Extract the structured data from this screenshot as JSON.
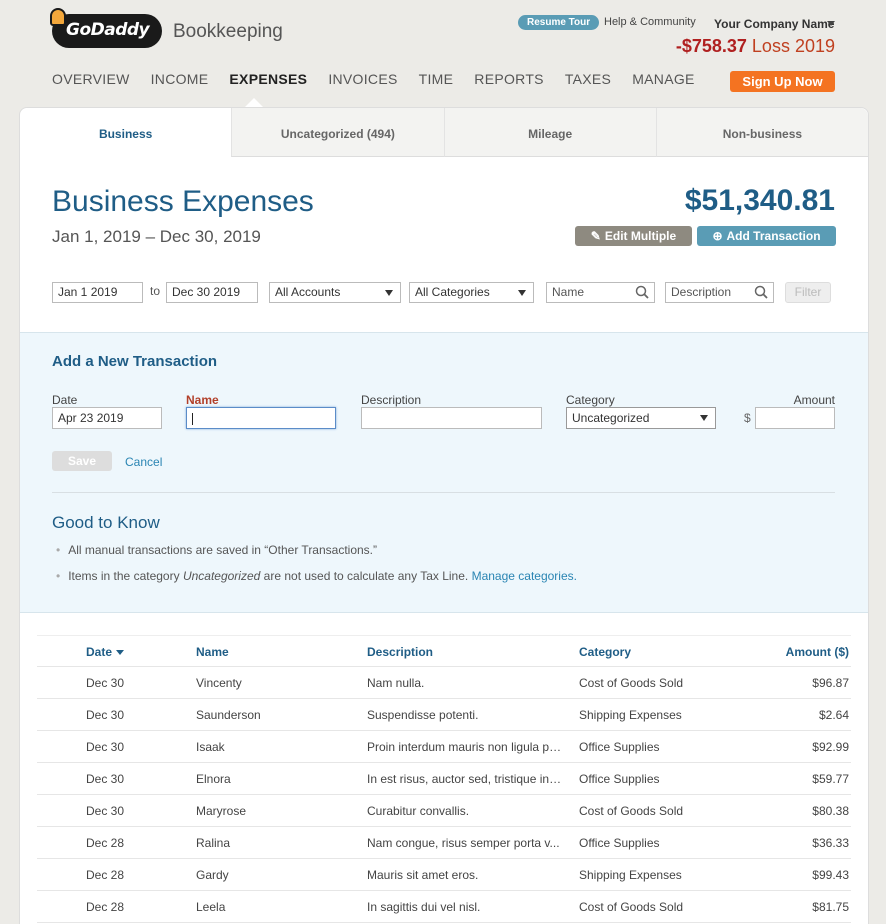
{
  "header": {
    "logo_text": "GoDaddy",
    "product": "Bookkeeping",
    "resume_tour": "Resume Tour",
    "help": "Help & Community",
    "company": "Your Company Name",
    "pl_amount": "-$758.37",
    "pl_label": "Loss 2019",
    "signup": "Sign Up Now"
  },
  "nav": [
    "OVERVIEW",
    "INCOME",
    "EXPENSES",
    "INVOICES",
    "TIME",
    "REPORTS",
    "TAXES",
    "MANAGE"
  ],
  "nav_active": "EXPENSES",
  "tabs": [
    "Business",
    "Uncategorized (494)",
    "Mileage",
    "Non-business"
  ],
  "page": {
    "title": "Business Expenses",
    "date_range": "Jan 1, 2019 – Dec 30, 2019",
    "total": "$51,340.81",
    "edit_multiple": "Edit Multiple",
    "add_transaction": "Add Transaction"
  },
  "filters": {
    "from": "Jan 1 2019",
    "to_label": "to",
    "to": "Dec 30 2019",
    "accounts": "All Accounts",
    "categories": "All Categories",
    "name_placeholder": "Name",
    "desc_placeholder": "Description",
    "filter_btn": "Filter"
  },
  "add_form": {
    "title": "Add a New Transaction",
    "date_label": "Date",
    "date_value": "Apr 23 2019",
    "name_label": "Name",
    "desc_label": "Description",
    "cat_label": "Category",
    "cat_value": "Uncategorized",
    "amount_label": "Amount",
    "currency": "$",
    "save": "Save",
    "cancel": "Cancel"
  },
  "good_to_know": {
    "title": "Good to Know",
    "item1": "All manual transactions are saved in “Other Transactions.”",
    "item2_pre": "Items in the category ",
    "item2_em": "Uncategorized",
    "item2_post": " are not used to calculate any Tax Line. ",
    "item2_link": "Manage categories."
  },
  "table": {
    "headers": {
      "date": "Date",
      "name": "Name",
      "desc": "Description",
      "cat": "Category",
      "amt": "Amount ($)"
    },
    "rows": [
      {
        "date": "Dec 30",
        "name": "Vincenty",
        "desc": "Nam nulla.",
        "cat": "Cost of Goods Sold",
        "amt": "$96.87"
      },
      {
        "date": "Dec 30",
        "name": "Saunderson",
        "desc": "Suspendisse potenti.",
        "cat": "Shipping Expenses",
        "amt": "$2.64"
      },
      {
        "date": "Dec 30",
        "name": "Isaak",
        "desc": "Proin interdum mauris non ligula pe...",
        "cat": "Office Supplies",
        "amt": "$92.99"
      },
      {
        "date": "Dec 30",
        "name": "Elnora",
        "desc": "In est risus, auctor sed, tristique in, ...",
        "cat": "Office Supplies",
        "amt": "$59.77"
      },
      {
        "date": "Dec 30",
        "name": "Maryrose",
        "desc": "Curabitur convallis.",
        "cat": "Cost of Goods Sold",
        "amt": "$80.38"
      },
      {
        "date": "Dec 28",
        "name": "Ralina",
        "desc": "Nam congue, risus semper porta v...",
        "cat": "Office Supplies",
        "amt": "$36.33"
      },
      {
        "date": "Dec 28",
        "name": "Gardy",
        "desc": "Mauris sit amet eros.",
        "cat": "Shipping Expenses",
        "amt": "$99.43"
      },
      {
        "date": "Dec 28",
        "name": "Leela",
        "desc": "In sagittis dui vel nisl.",
        "cat": "Cost of Goods Sold",
        "amt": "$81.75"
      }
    ]
  }
}
